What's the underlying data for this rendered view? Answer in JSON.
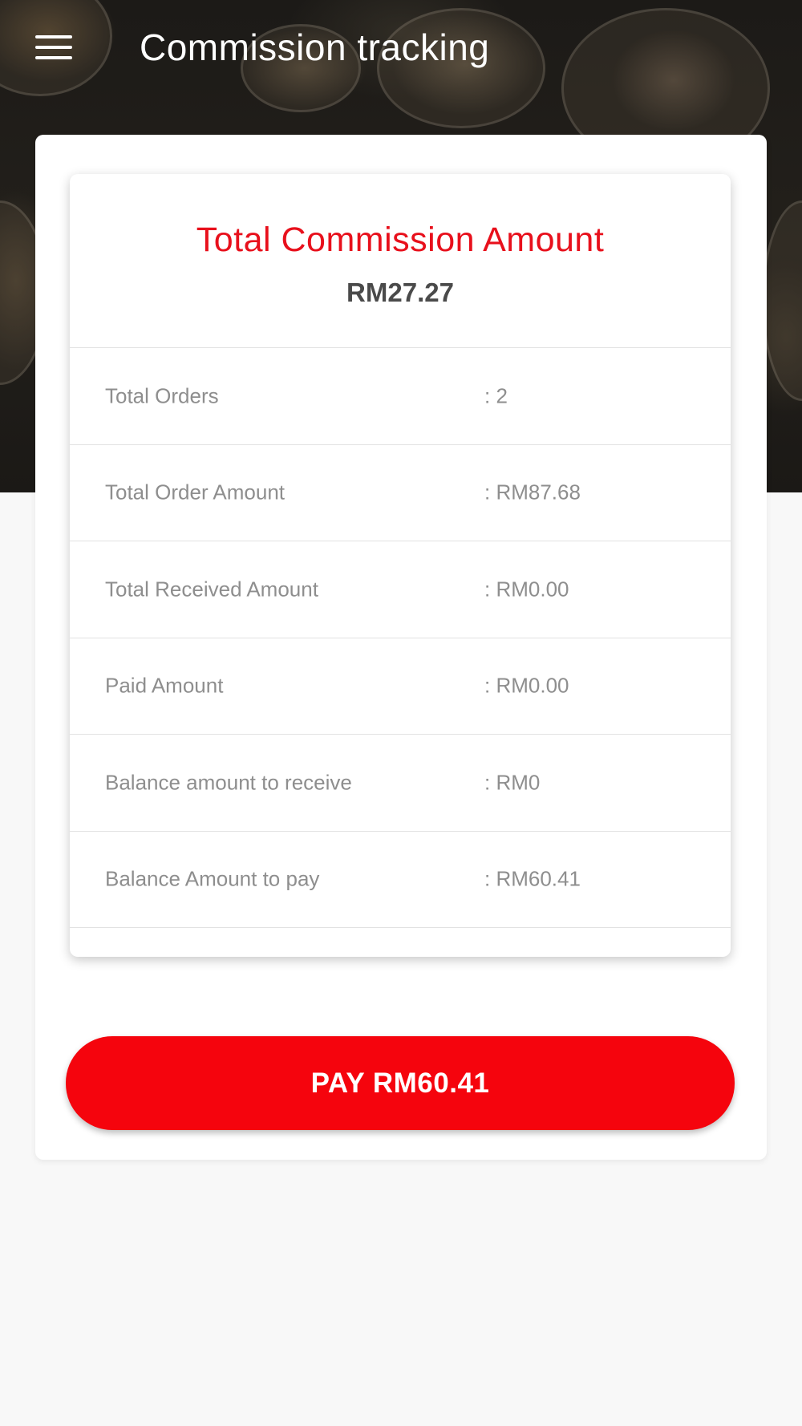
{
  "header": {
    "title": "Commission tracking",
    "menu_icon": "hamburger-menu-icon"
  },
  "summary": {
    "title": "Total Commission Amount",
    "amount": "RM27.27"
  },
  "rows": [
    {
      "label": "Total Orders",
      "value": ": 2"
    },
    {
      "label": "Total Order Amount",
      "value": ": RM87.68"
    },
    {
      "label": "Total Received Amount",
      "value": ": RM0.00"
    },
    {
      "label": "Paid Amount",
      "value": ": RM0.00"
    },
    {
      "label": "Balance amount to receive",
      "value": ": RM0"
    },
    {
      "label": "Balance Amount to pay",
      "value": ": RM60.41"
    }
  ],
  "actions": {
    "pay_label": "PAY RM60.41"
  },
  "colors": {
    "accent": "#e8101c",
    "button": "#f5040d",
    "text_muted": "#8e8e8e",
    "text_dark": "#4a4a4a"
  }
}
